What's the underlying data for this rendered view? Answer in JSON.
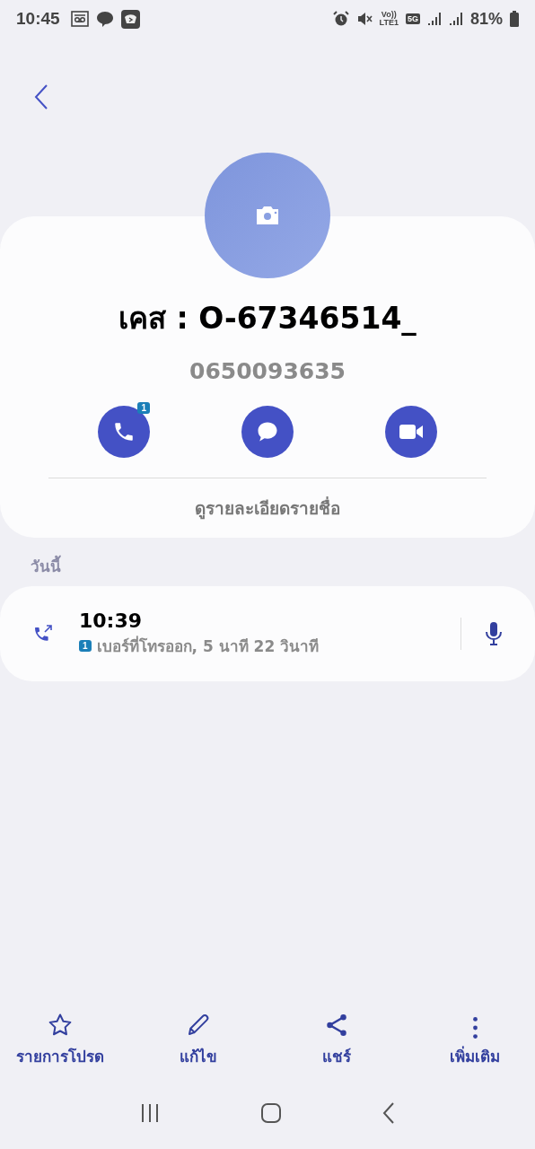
{
  "status_bar": {
    "time": "10:45",
    "volte": "Vo))",
    "lte": "LTE1",
    "network": "5G",
    "battery": "81%"
  },
  "contact": {
    "name": "เคส : O-67346514_",
    "number": "0650093635",
    "actions": [
      {
        "kind": "call",
        "badge": "1"
      },
      {
        "kind": "message"
      },
      {
        "kind": "video"
      }
    ],
    "details_link": "ดูรายละเอียดรายชื่อ"
  },
  "history": {
    "section": "วันนี้",
    "calls": [
      {
        "time": "10:39",
        "sim": "1",
        "description": "เบอร์ที่โทรออก, 5 นาที 22 วินาที"
      }
    ]
  },
  "bottom_actions": [
    {
      "kind": "favorite",
      "label": "รายการโปรด"
    },
    {
      "kind": "edit",
      "label": "แก้ไข"
    },
    {
      "kind": "share",
      "label": "แชร์"
    },
    {
      "kind": "more",
      "label": "เพิ่มเติม"
    }
  ]
}
